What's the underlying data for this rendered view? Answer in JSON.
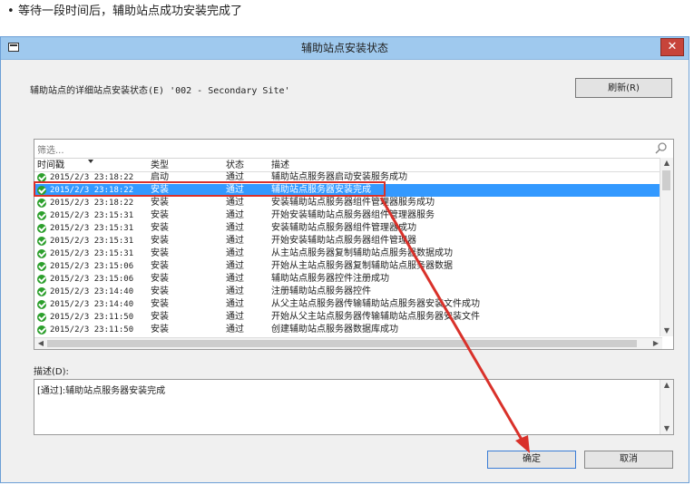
{
  "caption": {
    "bullet": "•",
    "text": "等待一段时间后，辅助站点成功安装完成了"
  },
  "dialog": {
    "title": "辅助站点安装状态",
    "close": "✕",
    "status_label": "辅助站点的详细站点安装状态(E) '002 - Secondary Site'",
    "refresh_button": "刷新(R)"
  },
  "list": {
    "filter_placeholder": "筛选...",
    "columns": {
      "time": "时间戳",
      "type": "类型",
      "status": "状态",
      "description": "描述"
    },
    "rows": [
      {
        "time": "2015/2/3 23:18:22",
        "type": "启动",
        "status": "通过",
        "description": "辅助站点服务器启动安装服务成功"
      },
      {
        "time": "2015/2/3 23:18:22",
        "type": "安装",
        "status": "通过",
        "description": "辅助站点服务器安装完成",
        "selected": true
      },
      {
        "time": "2015/2/3 23:18:22",
        "type": "安装",
        "status": "通过",
        "description": "安装辅助站点服务器组件管理器服务成功"
      },
      {
        "time": "2015/2/3 23:15:31",
        "type": "安装",
        "status": "通过",
        "description": "开始安装辅助站点服务器组件管理器服务"
      },
      {
        "time": "2015/2/3 23:15:31",
        "type": "安装",
        "status": "通过",
        "description": "安装辅助站点服务器组件管理器成功"
      },
      {
        "time": "2015/2/3 23:15:31",
        "type": "安装",
        "status": "通过",
        "description": "开始安装辅助站点服务器组件管理器"
      },
      {
        "time": "2015/2/3 23:15:31",
        "type": "安装",
        "status": "通过",
        "description": "从主站点服务器复制辅助站点服务器数据成功"
      },
      {
        "time": "2015/2/3 23:15:06",
        "type": "安装",
        "status": "通过",
        "description": "开始从主站点服务器复制辅助站点服务器数据"
      },
      {
        "time": "2015/2/3 23:15:06",
        "type": "安装",
        "status": "通过",
        "description": "辅助站点服务器控件注册成功"
      },
      {
        "time": "2015/2/3 23:14:40",
        "type": "安装",
        "status": "通过",
        "description": "注册辅助站点服务器控件"
      },
      {
        "time": "2015/2/3 23:14:40",
        "type": "安装",
        "status": "通过",
        "description": "从父主站点服务器传输辅助站点服务器安装文件成功"
      },
      {
        "time": "2015/2/3 23:11:50",
        "type": "安装",
        "status": "通过",
        "description": "开始从父主站点服务器传输辅助站点服务器安装文件"
      },
      {
        "time": "2015/2/3 23:11:50",
        "type": "安装",
        "status": "通过",
        "description": "创建辅助站点服务器数据库成功"
      }
    ]
  },
  "description": {
    "label": "描述(D):",
    "text": "[通过]:辅助站点服务器安装完成"
  },
  "buttons": {
    "ok": "确定",
    "cancel": "取消"
  },
  "icons": {
    "row_status": "check-circle-icon",
    "search": "search-icon"
  },
  "colors": {
    "selection": "#3399ff",
    "highlight": "#d9312a",
    "titlebar": "#9fc9ee"
  }
}
